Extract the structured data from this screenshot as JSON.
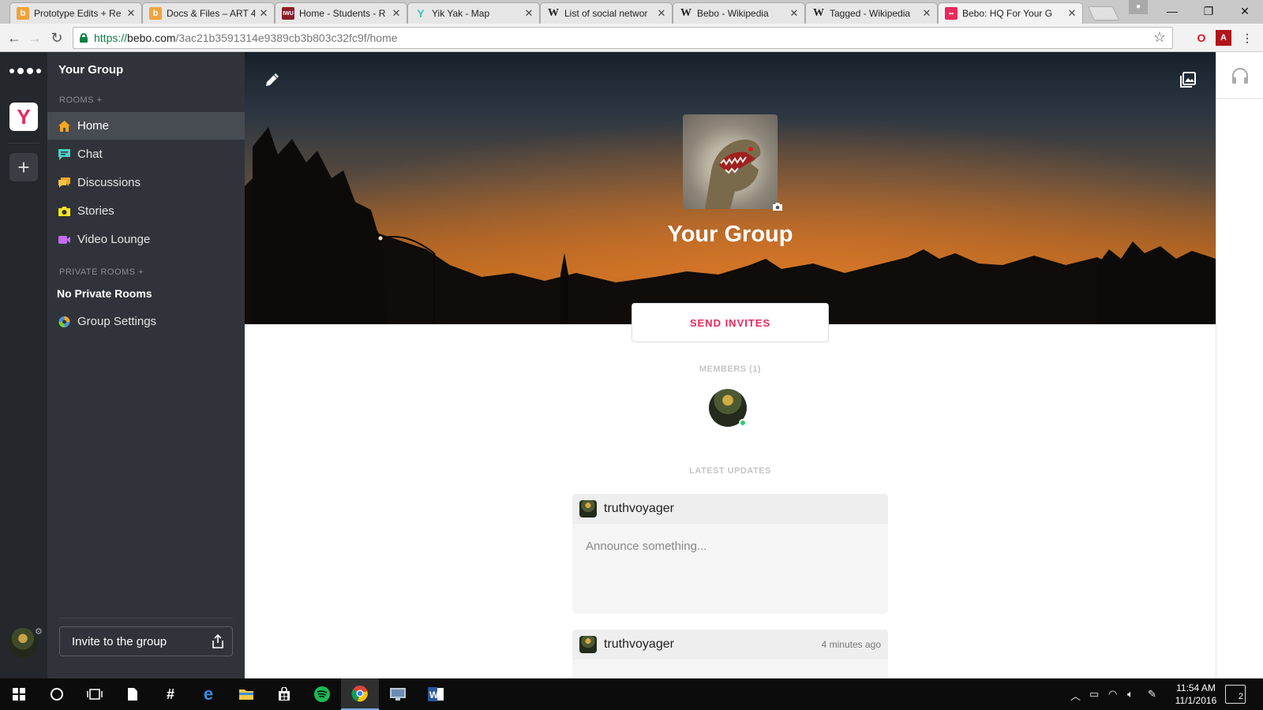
{
  "browser": {
    "tabs": [
      {
        "title": "Prototype Edits + Re",
        "fav": "b",
        "fav_color": "#f0a33c"
      },
      {
        "title": "Docs & Files – ART 4",
        "fav": "b",
        "fav_color": "#f0a33c"
      },
      {
        "title": "Home - Students - R",
        "fav": "IWU",
        "fav_color": "#8a1f2b"
      },
      {
        "title": "Yik Yak - Map",
        "fav": "Y",
        "fav_color": "#3ec3b3"
      },
      {
        "title": "List of social networ",
        "fav": "W",
        "fav_color": "#222222"
      },
      {
        "title": "Bebo - Wikipedia",
        "fav": "W",
        "fav_color": "#222222"
      },
      {
        "title": "Tagged - Wikipedia",
        "fav": "W",
        "fav_color": "#222222"
      },
      {
        "title": "Bebo: HQ For Your G",
        "fav": "••",
        "fav_color": "#e9285c"
      }
    ],
    "url_secure": "https://",
    "url_host": "bebo.com",
    "url_path": "/3ac21b3591314e9389cb3b803c32fc9f/home"
  },
  "rail": {
    "group_initial": "Y",
    "add_label": "+"
  },
  "sidebar": {
    "group_name": "Your Group",
    "rooms_label": "ROOMS +",
    "rooms": [
      {
        "label": "Home",
        "icon": "home-icon",
        "color": "#f5a623"
      },
      {
        "label": "Chat",
        "icon": "chat-icon",
        "color": "#4fd1c5"
      },
      {
        "label": "Discussions",
        "icon": "discussions-icon",
        "color": "#f5a623"
      },
      {
        "label": "Stories",
        "icon": "camera-icon",
        "color": "#f8e71c"
      },
      {
        "label": "Video Lounge",
        "icon": "video-icon",
        "color": "#c56cf0"
      }
    ],
    "private_label": "PRIVATE ROOMS +",
    "no_private": "No Private Rooms",
    "settings_label": "Group Settings",
    "invite_label": "Invite to the group"
  },
  "main": {
    "group_title": "Your Group",
    "send_invites": "SEND INVITES",
    "members_label": "MEMBERS (1)",
    "updates_label": "LATEST UPDATES",
    "composer_user": "truthvoyager",
    "composer_placeholder": "Announce something...",
    "post_user": "truthvoyager",
    "post_time": "4 minutes ago"
  },
  "taskbar": {
    "time": "11:54 AM",
    "date": "11/1/2016",
    "notifications": "2"
  },
  "colors": {
    "accent": "#e9285c",
    "sidebar_bg": "#30343a",
    "rail_bg": "#24272c"
  }
}
